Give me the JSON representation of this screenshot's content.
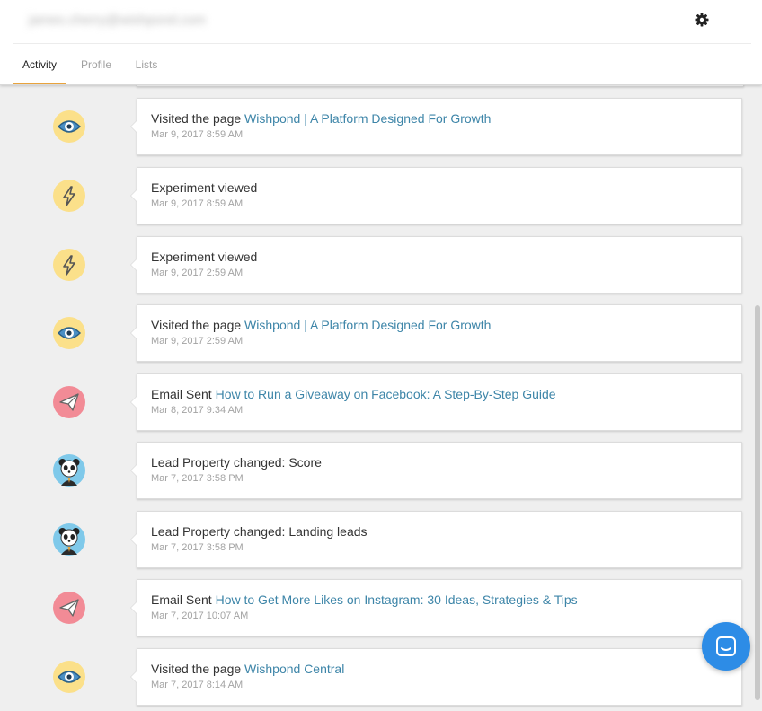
{
  "header": {
    "email": "james.cherry@wishpond.com",
    "settings_icon": "gear-icon"
  },
  "tabs": [
    {
      "label": "Activity",
      "active": true
    },
    {
      "label": "Profile",
      "active": false
    },
    {
      "label": "Lists",
      "active": false
    }
  ],
  "activities": [
    {
      "icon": "eye-icon",
      "icon_bg": "#fbe08a",
      "prefix": "Visited the page ",
      "link": "Wishpond | A Platform Designed For Growth",
      "time": "Mar 9, 2017 8:59 AM"
    },
    {
      "icon": "lightning-icon",
      "icon_bg": "#fbe08a",
      "prefix": "Experiment viewed",
      "link": "",
      "time": "Mar 9, 2017 8:59 AM"
    },
    {
      "icon": "lightning-icon",
      "icon_bg": "#fbe08a",
      "prefix": "Experiment viewed",
      "link": "",
      "time": "Mar 9, 2017 2:59 AM"
    },
    {
      "icon": "eye-icon",
      "icon_bg": "#fbe08a",
      "prefix": "Visited the page ",
      "link": "Wishpond | A Platform Designed For Growth",
      "time": "Mar 9, 2017 2:59 AM"
    },
    {
      "icon": "paper-plane-icon",
      "icon_bg": "#f28b96",
      "prefix": "Email Sent ",
      "link": "How to Run a Giveaway on Facebook: A Step-By-Step Guide",
      "time": "Mar 8, 2017 9:34 AM"
    },
    {
      "icon": "panda-icon",
      "icon_bg": "#7fc9ea",
      "prefix": "Lead Property changed: Score",
      "link": "",
      "time": "Mar 7, 2017 3:58 PM"
    },
    {
      "icon": "panda-icon",
      "icon_bg": "#7fc9ea",
      "prefix": "Lead Property changed: Landing leads",
      "link": "",
      "time": "Mar 7, 2017 3:58 PM"
    },
    {
      "icon": "paper-plane-icon",
      "icon_bg": "#f28b96",
      "prefix": "Email Sent ",
      "link": "How to Get More Likes on Instagram: 30 Ideas, Strategies & Tips",
      "time": "Mar 7, 2017 10:07 AM"
    },
    {
      "icon": "eye-icon",
      "icon_bg": "#fbe08a",
      "prefix": "Visited the page ",
      "link": "Wishpond Central",
      "time": "Mar 7, 2017 8:14 AM"
    }
  ],
  "chat": {
    "icon": "chat-icon",
    "color": "#2d8ce6"
  }
}
